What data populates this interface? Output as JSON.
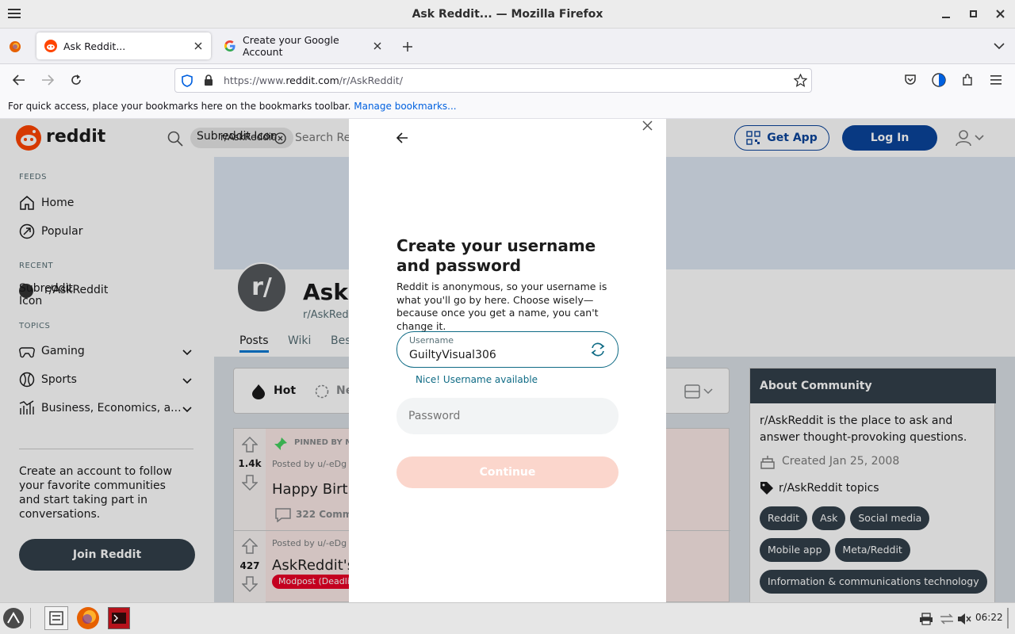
{
  "window": {
    "title": "Ask Reddit... — Mozilla Firefox"
  },
  "tabs": [
    {
      "label": "Ask Reddit..."
    },
    {
      "label": "Create your Google Account"
    }
  ],
  "urlbar": {
    "prefix": "https://www.",
    "domain": "reddit.com",
    "path": "/r/AskReddit/"
  },
  "bookmarks": {
    "hint": "For quick access, place your bookmarks here on the bookmarks toolbar.",
    "manage_link": "Manage bookmarks..."
  },
  "reddit": {
    "logo_text": "reddit",
    "search": {
      "chip_label": "r/AskReddit",
      "chip_alt": "Subreddit Icon",
      "placeholder": "Search Re"
    },
    "header": {
      "get_app": "Get App",
      "login": "Log In"
    },
    "sidebar": {
      "feeds_label": "FEEDS",
      "feeds": [
        "Home",
        "Popular"
      ],
      "recent_label": "RECENT",
      "recent_item": "r/AskReddit",
      "recent_alt": "Subreddit Icon",
      "topics_label": "TOPICS",
      "topics": [
        "Gaming",
        "Sports",
        "Business, Economics, a..."
      ],
      "cta": "Create an account to follow your favorite communities and start taking part in conversations.",
      "join": "Join Reddit"
    },
    "community": {
      "avatar": "r/",
      "name": "Ask",
      "handle": "r/AskRed",
      "tabs": [
        "Posts",
        "Wiki",
        "Bes"
      ]
    },
    "sort": {
      "hot": "Hot",
      "new": "Ne"
    },
    "posts": [
      {
        "score": "1.4k",
        "pinned": "PINNED BY M",
        "meta": "Posted by u/-eDg",
        "title": "Happy Birth",
        "comments": "322 Comme"
      },
      {
        "score": "427",
        "meta": "Posted by u/-eDg",
        "title": "AskReddit's",
        "flair": "Modpost (Deadli"
      }
    ],
    "about": {
      "header": "About Community",
      "desc": "r/AskReddit is the place to ask and answer thought-provoking questions.",
      "created": "Created Jan 25, 2008",
      "topics_label": "r/AskReddit topics",
      "tags": [
        "Reddit",
        "Ask",
        "Social media",
        "Mobile app",
        "Meta/Reddit",
        "Information & communications technology"
      ]
    }
  },
  "modal": {
    "title": "Create your username and password",
    "desc": "Reddit is anonymous, so your username is what you'll go by here. Choose wisely—because once you get a name, you can't change it.",
    "username_label": "Username",
    "username_value": "GuiltyVisual306",
    "status": "Nice! Username available",
    "password_placeholder": "Password",
    "continue": "Continue"
  },
  "taskbar": {
    "clock": "06:22"
  },
  "colors": {
    "reddit_orange": "#ff4500",
    "reddit_blue": "#0a449b",
    "modal_focus": "#0f6b85",
    "continue_disabled": "#fbd6cc"
  }
}
